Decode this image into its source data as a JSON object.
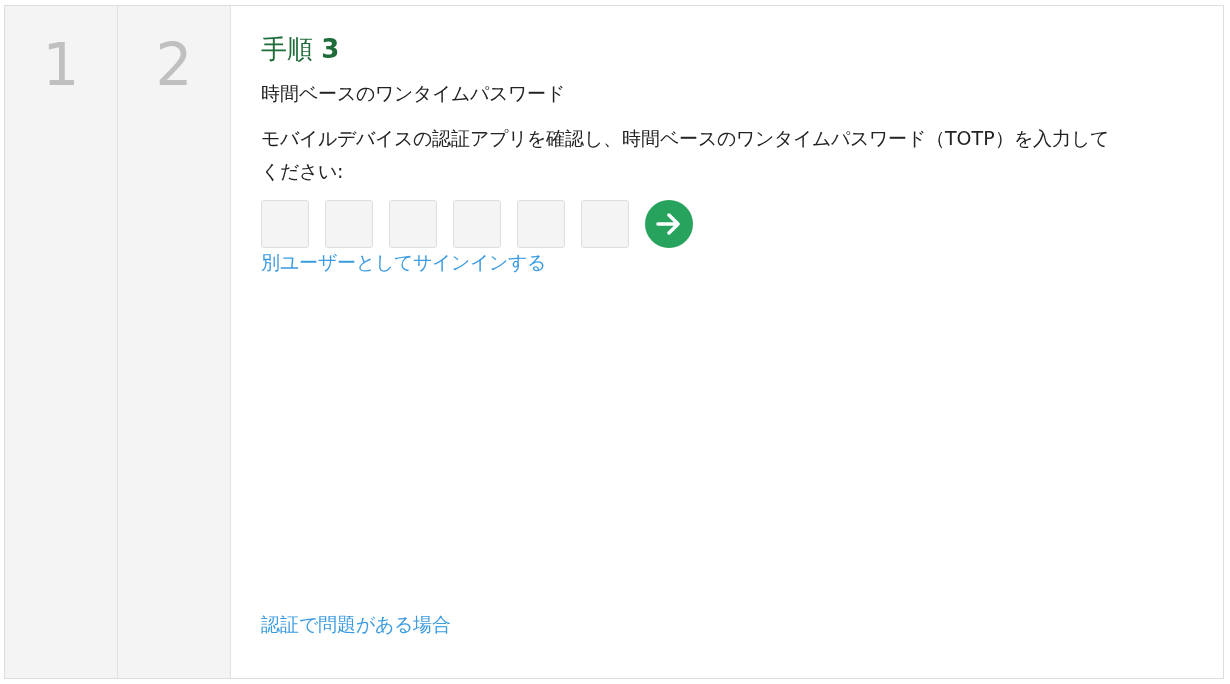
{
  "completed_steps": [
    {
      "number": "1"
    },
    {
      "number": "2"
    }
  ],
  "step_title": "手順 **3**",
  "subtitle": "時間ベースのワンタイムパスワード",
  "instructions": "モバイルデバイスの認証アプリを確認し、時間ベースのワンタイムパスワード（TOTP）を入力してください:",
  "code_fields": [
    {
      "filled": false
    },
    {
      "filled": false
    },
    {
      "filled": false
    },
    {
      "filled": false
    },
    {
      "filled": false
    },
    {
      "filled": false
    }
  ],
  "submit_button": {
    "kind": "arrow"
  },
  "switch_user_link": "別ユーザーとしてサインインする",
  "help_link": "認証で問題がある場合"
}
